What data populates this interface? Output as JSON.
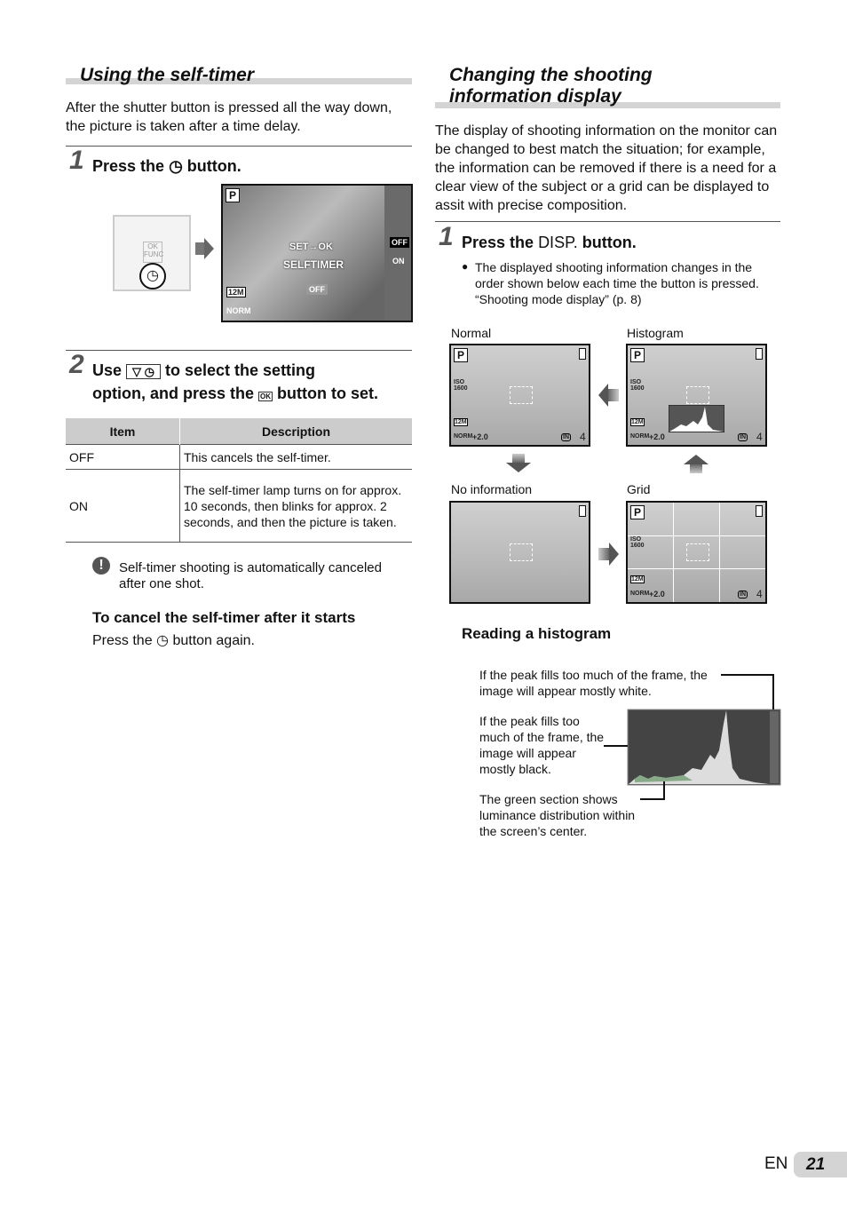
{
  "left": {
    "title": "Using the self-timer",
    "intro": "After the shutter button is pressed all the way down, the picture is taken after a time delay.",
    "step1": {
      "num": "1",
      "text_a": "Press the",
      "text_b": "button."
    },
    "pad": {
      "ok": "OK",
      "func": "FUNC"
    },
    "screen1": {
      "mode": "P",
      "set": "SET→OK",
      "selftimer": "SELFTIMER",
      "value": "OFF",
      "menu_off": "OFF",
      "menu_on": "ON",
      "size": "12M",
      "quality": "NORM"
    },
    "step2": {
      "num": "2",
      "line1_a": "Use",
      "line1_b": "to select the setting",
      "line2_a": "option, and press the",
      "line2_b": "button to set."
    },
    "table": {
      "headers": [
        "Item",
        "Description"
      ],
      "rows": [
        {
          "item": "OFF",
          "desc": "This cancels the self-timer."
        },
        {
          "item": "ON",
          "desc": "The self-timer lamp turns on for approx. 10 seconds, then blinks for approx. 2 seconds, and then the picture is taken."
        }
      ]
    },
    "note": "Self-timer shooting is automatically canceled after one shot.",
    "cancel_title": "To cancel the self-timer after it starts",
    "cancel_a": "Press the",
    "cancel_b": "button again."
  },
  "right": {
    "title_l1": "Changing the shooting",
    "title_l2": "information display",
    "intro": "The display of shooting information on the monitor can be changed to best match the situation; for example, the information can be removed if there is a need for a clear view of the subject or a grid can be displayed to assit with precise composition.",
    "step1": {
      "num": "1",
      "text_a": "Press the",
      "disp": "DISP.",
      "text_b": "button."
    },
    "bullet": "The displayed shooting information changes in the order shown below each time the button is pressed. “Shooting mode display” (p. 8)",
    "screens": {
      "normal": "Normal",
      "histogram": "Histogram",
      "noinfo": "No information",
      "grid": "Grid"
    },
    "osd": {
      "mode": "P",
      "iso": "ISO 1600",
      "size": "12M",
      "quality": "NORM",
      "ev": "+2.0",
      "mem": "IN",
      "count": "4"
    },
    "hist_title": "Reading a histogram",
    "hist_white": "If the peak fills too much of the frame, the image will appear mostly white.",
    "hist_black": "If the peak fills too much of the frame, the image will appear mostly black.",
    "hist_green": "The green section shows luminance distribution within the screen’s center."
  },
  "footer": {
    "lang": "EN",
    "page": "21"
  }
}
